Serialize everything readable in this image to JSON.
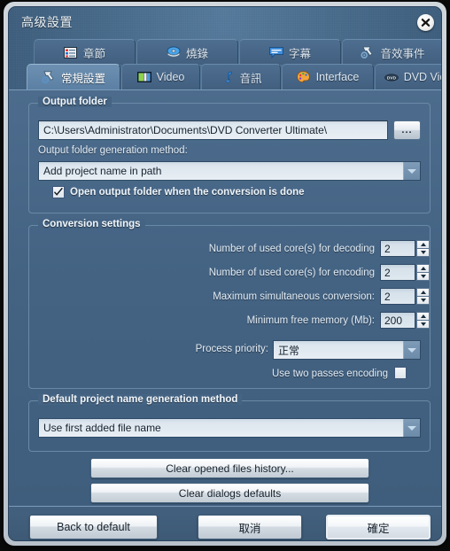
{
  "window": {
    "title": "高级設置",
    "close_icon": "close-icon"
  },
  "tabs_top": [
    {
      "label": "章節",
      "icon": "chapter-icon"
    },
    {
      "label": "燒錄",
      "icon": "burn-disc-icon"
    },
    {
      "label": "字幕",
      "icon": "subtitle-icon"
    },
    {
      "label": "音效事件",
      "icon": "sound-event-icon"
    }
  ],
  "tabs_bottom": [
    {
      "label": "常規設置",
      "icon": "general-settings-icon",
      "active": true
    },
    {
      "label": "Video",
      "icon": "video-icon",
      "active": false
    },
    {
      "label": "音訊",
      "icon": "audio-note-icon",
      "active": false
    },
    {
      "label": "Interface",
      "icon": "interface-palette-icon",
      "active": false
    },
    {
      "label": "DVD Video",
      "icon": "dvd-icon",
      "active": false
    }
  ],
  "output_folder": {
    "group_title": "Output folder",
    "path_value": "C:\\Users\\Administrator\\Documents\\DVD Converter Ultimate\\",
    "path_placeholder": "",
    "browse_label": "...",
    "generation_method_label": "Output folder generation method:",
    "generation_method_value": "Add project name in path",
    "open_when_done_label": "Open output folder when the conversion is done",
    "open_when_done_checked": true
  },
  "conversion_settings": {
    "group_title": "Conversion settings",
    "rows": [
      {
        "label": "Number of used core(s) for decoding",
        "value": "2"
      },
      {
        "label": "Number of used core(s) for encoding",
        "value": "2"
      },
      {
        "label": "Maximum simultaneous conversion:",
        "value": "2"
      },
      {
        "label": "Minimum free memory (Mb):",
        "value": "200"
      }
    ],
    "process_priority_label": "Process priority:",
    "process_priority_value": "正常",
    "two_passes_label": "Use two passes encoding",
    "two_passes_checked": false
  },
  "project_name": {
    "group_title": "Default project name generation method",
    "method_value": "Use first added file name"
  },
  "actions": {
    "clear_history_label": "Clear opened files history...",
    "clear_dialogs_label": "Clear dialogs defaults"
  },
  "footer": {
    "back_to_default_label": "Back to default",
    "cancel_label": "取消",
    "ok_label": "確定"
  },
  "colors": {
    "dialog_bg": "#456484",
    "panel_bg": "#446383",
    "tab_active_bg": "#6d90b2",
    "group_border": "#6a89a7",
    "field_bg": "#e9eff4",
    "text_light": "#e3ecf4"
  }
}
